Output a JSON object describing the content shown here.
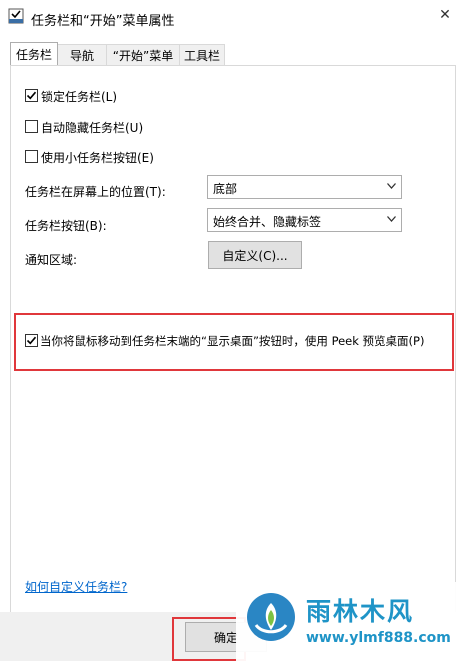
{
  "window": {
    "title": "任务栏和“开始”菜单属性",
    "close_glyph": "✕"
  },
  "tabs": [
    {
      "label": "任务栏",
      "active": true
    },
    {
      "label": "导航",
      "active": false
    },
    {
      "label": "“开始”菜单",
      "active": false
    },
    {
      "label": "工具栏",
      "active": false
    }
  ],
  "options": {
    "lock_taskbar": {
      "label": "锁定任务栏(L)",
      "checked": true
    },
    "auto_hide": {
      "label": "自动隐藏任务栏(U)",
      "checked": false
    },
    "small_buttons": {
      "label": "使用小任务栏按钮(E)",
      "checked": false
    }
  },
  "location": {
    "label": "任务栏在屏幕上的位置(T):",
    "value": "底部"
  },
  "buttons_mode": {
    "label": "任务栏按钮(B):",
    "value": "始终合并、隐藏标签"
  },
  "notification": {
    "label": "通知区域:",
    "button": "自定义(C)..."
  },
  "peek": {
    "label": "当你将鼠标移动到任务栏末端的“显示桌面”按钮时，使用 Peek 预览桌面(P)",
    "checked": true
  },
  "help_link": "如何自定义任务栏?",
  "footer": {
    "ok_label": "确定"
  },
  "watermark": {
    "name": "雨林木风",
    "url": "www.ylmf888.com"
  },
  "colors": {
    "highlight": "#e0373b",
    "link": "#0066cc",
    "watermark": "#1f94c7"
  }
}
